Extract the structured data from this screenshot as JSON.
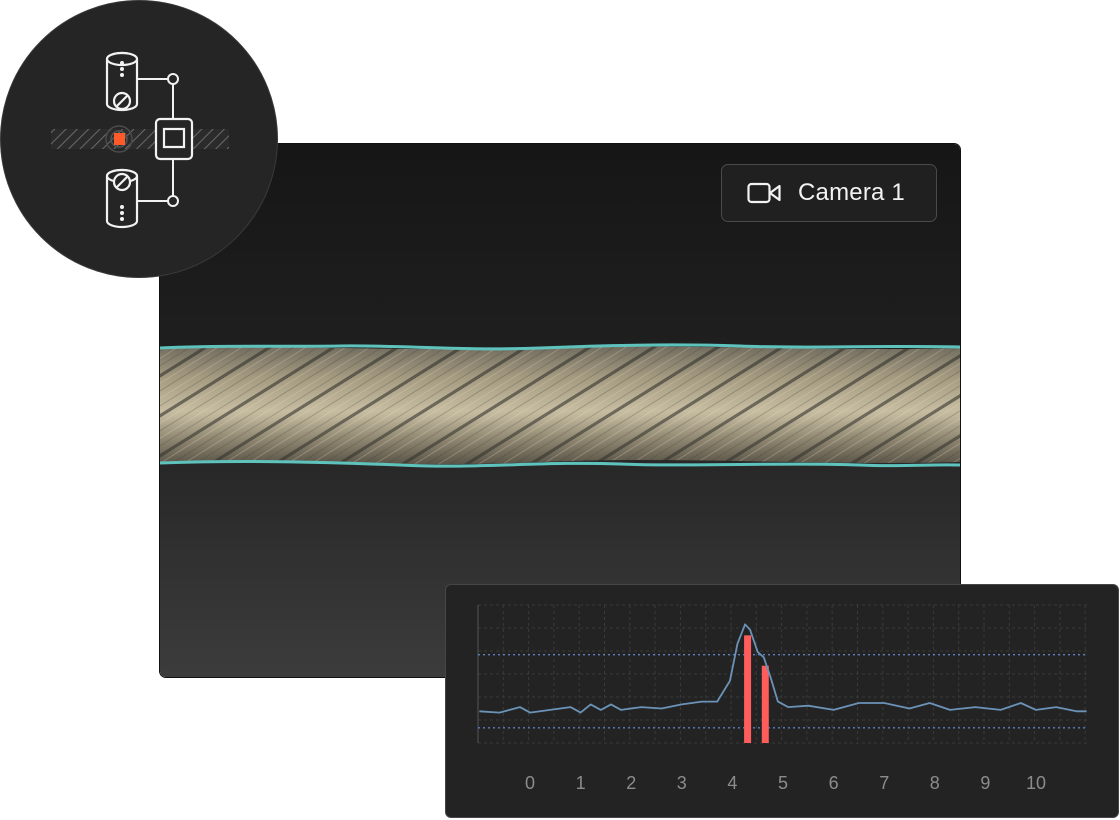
{
  "camera": {
    "label": "Camera 1",
    "icon": "video-camera-icon"
  },
  "diagram": {
    "icons": [
      "sensor-top-icon",
      "sensor-bottom-icon",
      "clamp-icon",
      "defect-marker-icon"
    ],
    "defect_color": "#ff5a2a"
  },
  "colors": {
    "outline": "#5fc3bd",
    "signal": "#6b93b8",
    "defect": "#ff5c5c",
    "threshold": "#5b7fc0"
  },
  "chart_data": {
    "type": "line",
    "x_ticks": [
      "0",
      "1",
      "2",
      "3",
      "4",
      "5",
      "6",
      "7",
      "8",
      "9",
      "10"
    ],
    "xlim": [
      -1,
      11
    ],
    "ylim": [
      0,
      1
    ],
    "grid": true,
    "series": [
      {
        "values": [
          [
            -1,
            0.23
          ],
          [
            -0.6,
            0.22
          ],
          [
            -0.2,
            0.26
          ],
          [
            0,
            0.22
          ],
          [
            0.4,
            0.24
          ],
          [
            0.8,
            0.26
          ],
          [
            1,
            0.22
          ],
          [
            1.2,
            0.28
          ],
          [
            1.4,
            0.24
          ],
          [
            1.6,
            0.28
          ],
          [
            1.8,
            0.24
          ],
          [
            2.2,
            0.26
          ],
          [
            2.6,
            0.25
          ],
          [
            3.0,
            0.28
          ],
          [
            3.4,
            0.3
          ],
          [
            3.7,
            0.3
          ],
          [
            3.95,
            0.45
          ],
          [
            4.1,
            0.72
          ],
          [
            4.25,
            0.86
          ],
          [
            4.35,
            0.82
          ],
          [
            4.5,
            0.66
          ],
          [
            4.62,
            0.62
          ],
          [
            4.75,
            0.48
          ],
          [
            4.9,
            0.3
          ],
          [
            5.1,
            0.26
          ],
          [
            5.5,
            0.27
          ],
          [
            6.0,
            0.24
          ],
          [
            6.5,
            0.29
          ],
          [
            7.0,
            0.29
          ],
          [
            7.5,
            0.25
          ],
          [
            7.9,
            0.29
          ],
          [
            8.3,
            0.24
          ],
          [
            8.8,
            0.26
          ],
          [
            9.3,
            0.24
          ],
          [
            9.7,
            0.29
          ],
          [
            10.0,
            0.24
          ],
          [
            10.4,
            0.26
          ],
          [
            10.8,
            0.23
          ],
          [
            11.0,
            0.23
          ]
        ]
      }
    ],
    "thresholds": [
      0.64,
      0.11
    ],
    "defects": [
      {
        "x": 4.3,
        "height": 0.78
      },
      {
        "x": 4.65,
        "height": 0.56
      }
    ]
  }
}
